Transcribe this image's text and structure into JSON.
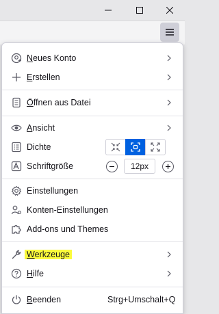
{
  "window": {
    "minimize_icon": "minimize-icon",
    "maximize_icon": "maximize-icon",
    "close_icon": "close-icon"
  },
  "toolbar": {
    "menu_button_icon": "hamburger-icon"
  },
  "menu": {
    "items": [
      {
        "label": "Neues Konto",
        "icon": "new-account-icon",
        "submenu": true
      },
      {
        "label": "Erstellen",
        "icon": "plus-icon",
        "submenu": true
      },
      {
        "label": "Öffnen aus Datei",
        "icon": "open-file-icon",
        "submenu": true
      },
      {
        "label": "Ansicht",
        "icon": "eye-icon",
        "submenu": true
      },
      {
        "label": "Dichte",
        "icon": "density-icon"
      },
      {
        "label": "Schriftgröße",
        "icon": "font-size-icon",
        "value": "12px"
      },
      {
        "label": "Einstellungen",
        "icon": "gear-icon"
      },
      {
        "label": "Konten-Einstellungen",
        "icon": "account-settings-icon"
      },
      {
        "label": "Add-ons und Themes",
        "icon": "puzzle-icon"
      },
      {
        "label": "Werkzeuge",
        "icon": "wrench-icon",
        "submenu": true,
        "highlighted": true
      },
      {
        "label": "Hilfe",
        "icon": "help-icon",
        "submenu": true
      },
      {
        "label": "Beenden",
        "icon": "power-icon",
        "shortcut": "Strg+Umschalt+Q"
      }
    ],
    "density_options": [
      "compact",
      "normal",
      "touch"
    ],
    "density_selected": "normal",
    "highlight_color": "#fbfb3b",
    "accent_color": "#0061e0"
  }
}
